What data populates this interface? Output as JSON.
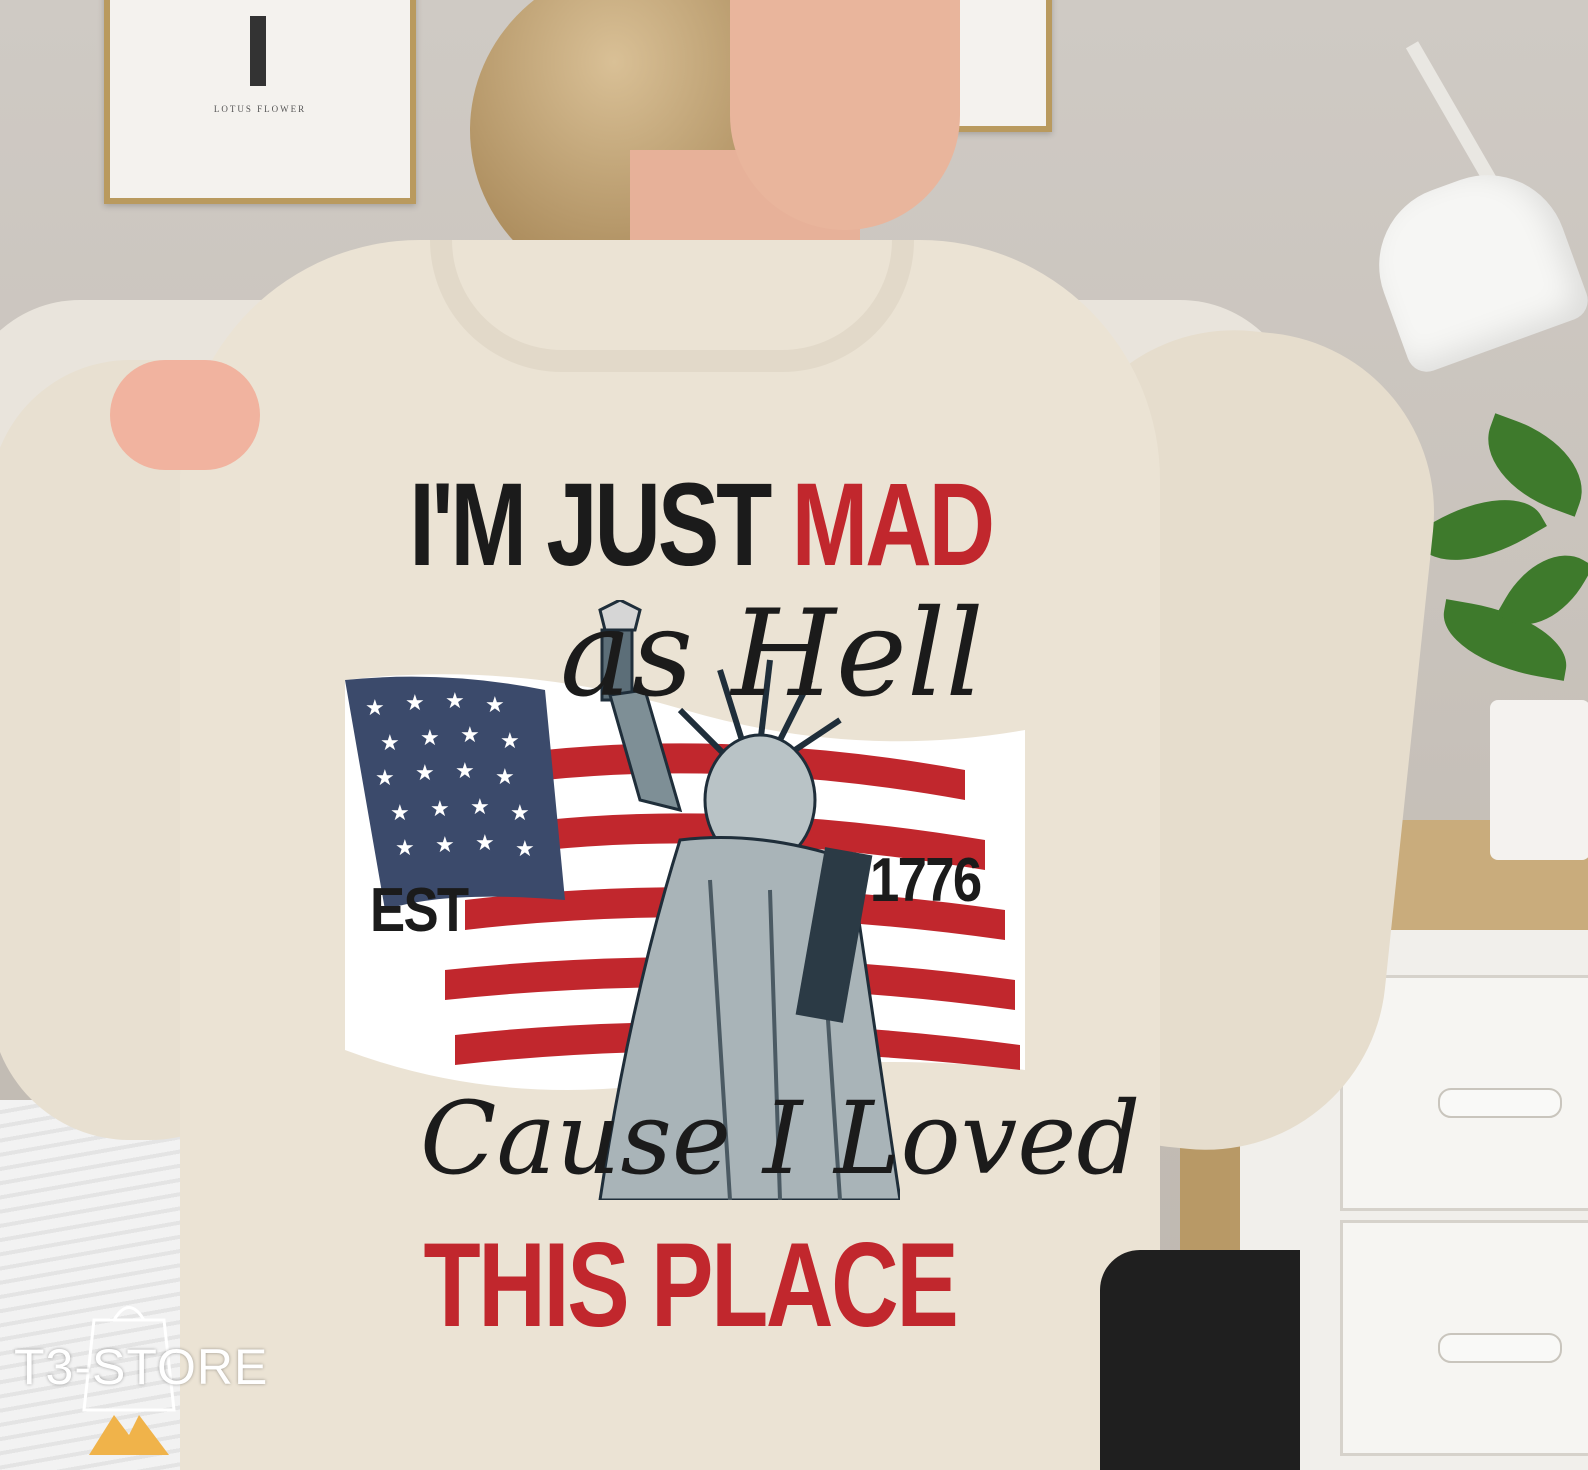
{
  "wall_art": {
    "caption": "LOTUS FLOWER"
  },
  "shirt_print": {
    "line1_black": "I'M JUST ",
    "line1_red": "MAD",
    "line2_script": "as Hell",
    "est": "EST",
    "year": "1776",
    "line3_script": "Cause I Loved",
    "line4": "THIS PLACE"
  },
  "watermark": {
    "text": "T3-STORE"
  },
  "colors": {
    "red": "#c1272d",
    "navy": "#3b4a6b",
    "ink": "#1b1b1b",
    "sweater": "#ebe3d4"
  }
}
